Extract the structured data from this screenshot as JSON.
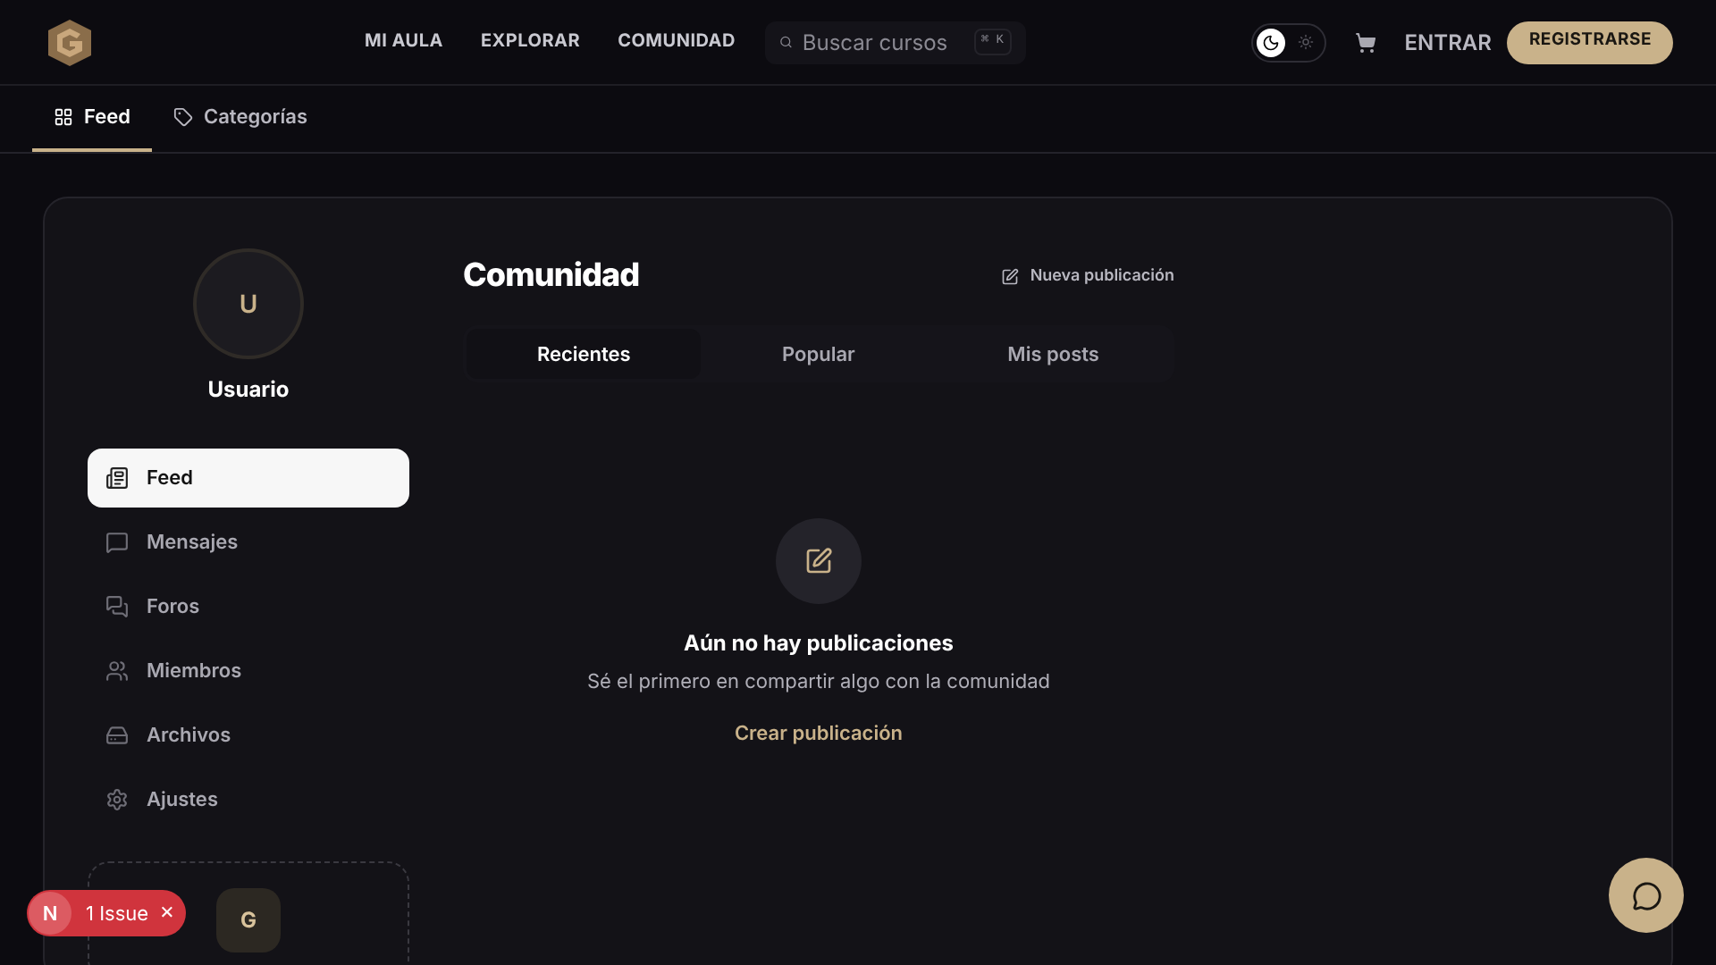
{
  "nav": {
    "links": [
      "MI AULA",
      "EXPLORAR",
      "COMUNIDAD"
    ],
    "search": {
      "placeholder": "Buscar cursos",
      "shortcut": "⌘ K"
    },
    "theme_toggle": {
      "dark": true
    },
    "login": "ENTRAR",
    "register": "REGISTRARSE"
  },
  "subtabs": [
    {
      "label": "Feed",
      "selected": true
    },
    {
      "label": "Categorías",
      "selected": false
    }
  ],
  "profile": {
    "initial": "U",
    "name": "Usuario"
  },
  "sidebar": [
    {
      "label": "Feed",
      "selected": true
    },
    {
      "label": "Mensajes",
      "selected": false
    },
    {
      "label": "Foros",
      "selected": false
    },
    {
      "label": "Miembros",
      "selected": false
    },
    {
      "label": "Archivos",
      "selected": false
    },
    {
      "label": "Ajustes",
      "selected": false
    }
  ],
  "promo_card": {
    "initial": "G"
  },
  "content": {
    "title": "Comunidad",
    "new_post": "Nueva publicación",
    "tabs": [
      {
        "label": "Recientes",
        "selected": true
      },
      {
        "label": "Popular",
        "selected": false
      },
      {
        "label": "Mis posts",
        "selected": false
      }
    ],
    "empty": {
      "title": "Aún no hay publicaciones",
      "text": "Sé el primero en compartir algo con la comunidad",
      "action": "Crear publicación"
    }
  },
  "issue_badge": {
    "initial": "N",
    "label": "1 Issue",
    "close": "×"
  }
}
